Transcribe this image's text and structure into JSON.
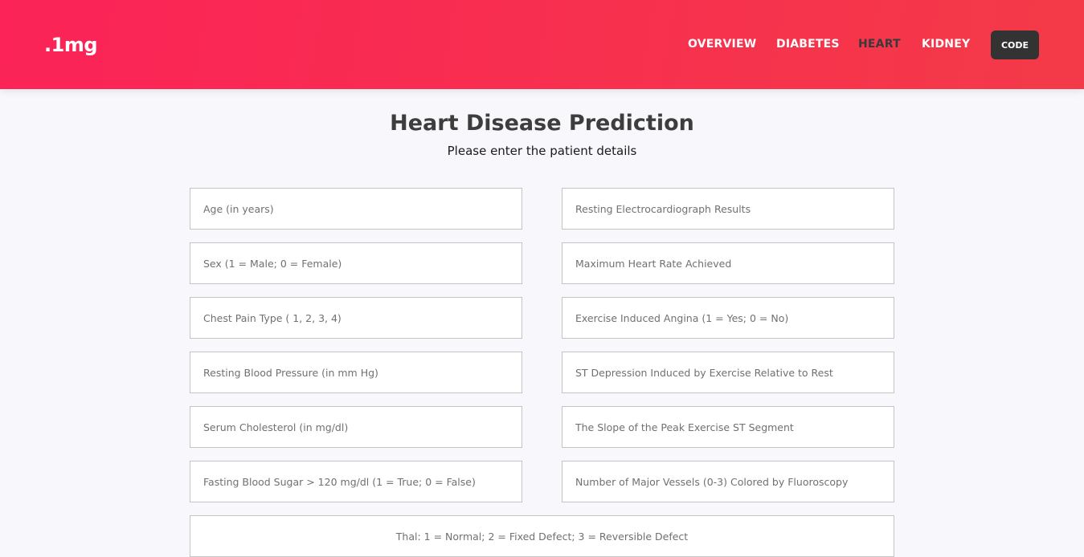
{
  "header": {
    "logo": ".1mg",
    "nav": [
      "OVERVIEW",
      "DIABETES",
      "HEART",
      "KIDNEY"
    ],
    "active_nav": "HEART",
    "code_button": "CODE"
  },
  "form": {
    "title": "Heart Disease Prediction",
    "subtitle": "Please enter the patient details",
    "fields": {
      "age": "Age (in years)",
      "sex": "Sex (1 = Male; 0 = Female)",
      "chest_pain": "Chest Pain Type ( 1, 2, 3, 4)",
      "resting_bp": "Resting Blood Pressure (in mm Hg)",
      "cholesterol": "Serum Cholesterol (in mg/dl)",
      "fasting_sugar": "Fasting Blood Sugar > 120 mg/dl (1 = True; 0 = False)",
      "ecg": "Resting Electrocardiograph Results",
      "max_heart_rate": "Maximum Heart Rate Achieved",
      "angina": "Exercise Induced Angina (1 = Yes; 0 = No)",
      "st_depression": "ST Depression Induced by Exercise Relative to Rest",
      "slope": "The Slope of the Peak Exercise ST Segment",
      "vessels": "Number of Major Vessels (0-3) Colored by Fluoroscopy",
      "thal": "Thal: 1 = Normal; 2 = Fixed Defect; 3 = Reversible Defect"
    }
  }
}
